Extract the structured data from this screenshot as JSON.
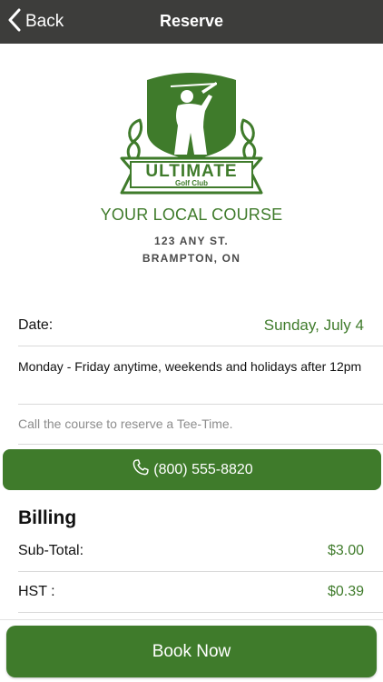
{
  "nav": {
    "back_label": "Back",
    "title": "Reserve"
  },
  "logo": {
    "line1": "ULTIMATE",
    "line2": "Golf Club"
  },
  "course": {
    "name": "YOUR LOCAL COURSE",
    "address_line1": "123 ANY ST.",
    "address_line2": "BRAMPTON, ON"
  },
  "reservation": {
    "date_label": "Date:",
    "date_value": "Sunday, July 4",
    "policy": "Monday - Friday anytime, weekends and holidays after 12pm",
    "note": "Call the course to reserve a Tee-Time.",
    "phone": "(800) 555-8820"
  },
  "billing": {
    "title": "Billing",
    "subtotal_label": "Sub-Total:",
    "subtotal_value": "$3.00",
    "hst_label": "HST :",
    "hst_value": "$0.39"
  },
  "actions": {
    "book_label": "Book Now"
  },
  "colors": {
    "accent": "#3f7b2b",
    "navbar": "#3d3d3b",
    "muted": "#8c8c8c"
  },
  "icons": {
    "back": "chevron-left-icon",
    "phone": "phone-icon"
  }
}
